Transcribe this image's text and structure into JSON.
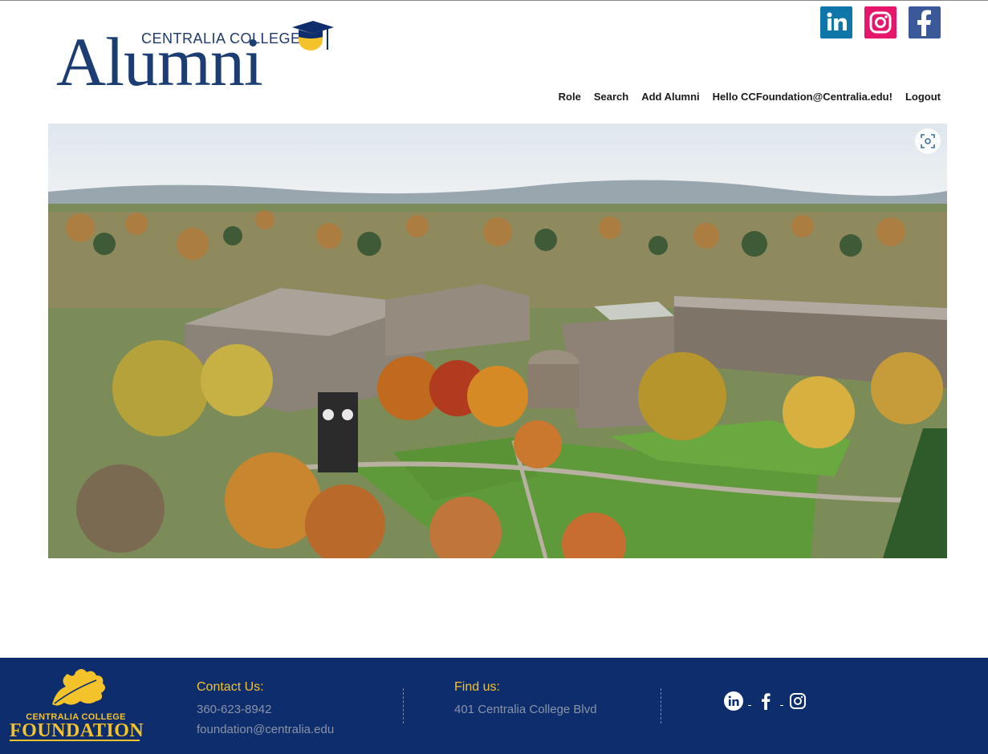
{
  "header": {
    "logo_college_text": "CENTRALIA COLLEGE",
    "logo_title": "Alumni",
    "social": [
      "linkedin-icon",
      "instagram-icon",
      "facebook-icon"
    ]
  },
  "nav": {
    "items": [
      "Role",
      "Search",
      "Add Alumni",
      "Hello CCFoundation@Centralia.edu!",
      "Logout"
    ]
  },
  "footer": {
    "logo_college": "CENTRALIA COLLEGE",
    "logo_foundation": "FOUNDATION",
    "contact_title": "Contact Us:",
    "phone": "360-623-8942",
    "email": "foundation@centralia.edu",
    "find_title": "Find us:",
    "address": "401 Centralia College Blvd"
  },
  "colors": {
    "brand_navy": "#0d2d6c",
    "brand_gold": "#f4c22b",
    "linkedin": "#0e76a8",
    "instagram": "#e6166b",
    "facebook": "#3b5998"
  }
}
